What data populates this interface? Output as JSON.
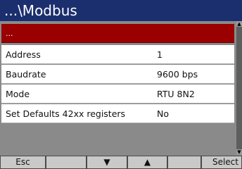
{
  "header": {
    "title": "...\\Modbus"
  },
  "list": {
    "items": [
      {
        "label": "...",
        "value": ""
      },
      {
        "label": "Address",
        "value": "1"
      },
      {
        "label": "Baudrate",
        "value": "9600 bps"
      },
      {
        "label": "Mode",
        "value": "RTU 8N2"
      },
      {
        "label": "Set Defaults 42xx registers",
        "value": "No"
      }
    ],
    "selected_index": 0
  },
  "scrollbar": {
    "up_arrow": "▲",
    "down_arrow": "▼"
  },
  "softkeys": [
    {
      "label": "Esc"
    },
    {
      "label": ""
    },
    {
      "label": "▼"
    },
    {
      "label": "▲"
    },
    {
      "label": ""
    },
    {
      "label": "Select"
    }
  ],
  "colors": {
    "title_bar": "#1b2f6e",
    "selected_row": "#9a0000",
    "background": "#8a8a8a"
  }
}
